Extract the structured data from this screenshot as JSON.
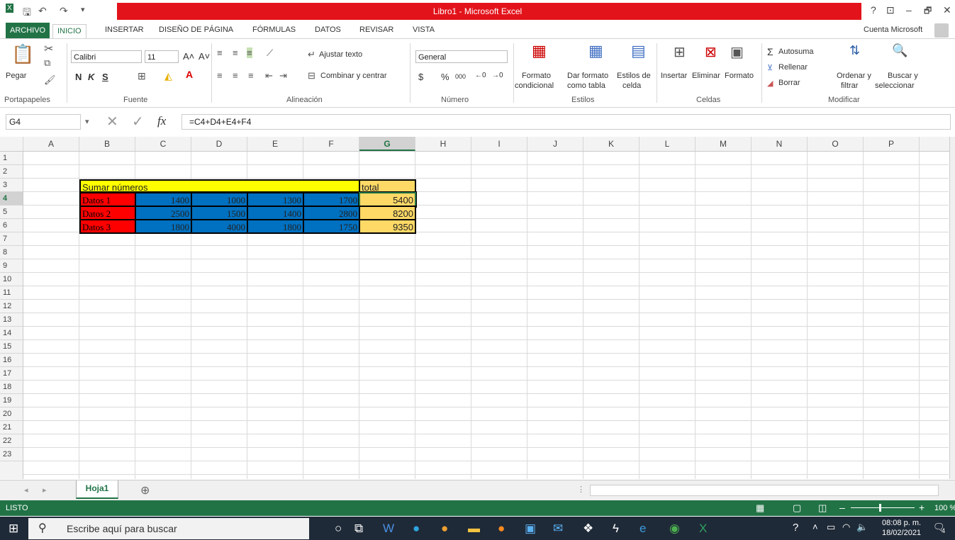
{
  "title": "Libro1 - Microsoft Excel",
  "window_buttons": [
    "?",
    "⊡",
    "–",
    "🗗",
    "✕"
  ],
  "tabs": {
    "file": "ARCHIVO",
    "items": [
      "INICIO",
      "INSERTAR",
      "DISEÑO DE PÁGINA",
      "FÓRMULAS",
      "DATOS",
      "REVISAR",
      "VISTA"
    ],
    "account": "Cuenta Microsoft"
  },
  "ribbon": {
    "clipboard": {
      "paste": "Pegar",
      "group": "Portapapeles"
    },
    "font": {
      "name": "Calibri",
      "size": "11",
      "bold": "N",
      "italic": "K",
      "underline": "S",
      "group": "Fuente"
    },
    "alignment": {
      "wrap": "Ajustar texto",
      "merge": "Combinar y centrar",
      "group": "Alineación"
    },
    "number": {
      "format": "General",
      "currency": "$",
      "percent": "%",
      "thousands": "000",
      "group": "Número"
    },
    "styles": {
      "conditional_1": "Formato",
      "conditional_2": "condicional",
      "table_1": "Dar formato",
      "table_2": "como tabla",
      "cell_1": "Estilos de",
      "cell_2": "celda",
      "group": "Estilos"
    },
    "cells": {
      "insert": "Insertar",
      "delete": "Eliminar",
      "format": "Formato",
      "group": "Celdas"
    },
    "editing": {
      "autosum": "Autosuma",
      "fill": "Rellenar",
      "clear": "Borrar",
      "sort_1": "Ordenar y",
      "sort_2": "filtrar",
      "find_1": "Buscar y",
      "find_2": "seleccionar",
      "group": "Modificar"
    }
  },
  "formula_bar": {
    "name_box": "G4",
    "fx": "fx",
    "formula": "=C4+D4+E4+F4"
  },
  "columns": [
    "A",
    "B",
    "C",
    "D",
    "E",
    "F",
    "G",
    "H",
    "I",
    "J",
    "K",
    "L",
    "M",
    "N",
    "O",
    "P"
  ],
  "selected_column": "G",
  "rows": [
    "1",
    "2",
    "3",
    "4",
    "5",
    "6",
    "7",
    "8",
    "9",
    "10",
    "11",
    "12",
    "13",
    "14",
    "15",
    "16",
    "17",
    "18",
    "19",
    "20",
    "21",
    "22",
    "23"
  ],
  "selected_row": "4",
  "cells": {
    "header_label": "Sumar números",
    "total_label": "total",
    "data_rows": [
      {
        "label": "Datos 1",
        "values": [
          "1400",
          "1000",
          "1300",
          "1700"
        ],
        "total": "5400"
      },
      {
        "label": "Datos 2",
        "values": [
          "2500",
          "1500",
          "1400",
          "2800"
        ],
        "total": "8200"
      },
      {
        "label": "Datos 3",
        "values": [
          "1800",
          "4000",
          "1800",
          "1750"
        ],
        "total": "9350"
      }
    ]
  },
  "sheet": {
    "tab": "Hoja1",
    "add": "⊕"
  },
  "status": {
    "ready": "LISTO",
    "zoom": "100 %"
  },
  "taskbar": {
    "search_placeholder": "Escribe aquí para buscar",
    "time": "08:08 p. m.",
    "date": "18/02/2021",
    "notifications": "4"
  },
  "colors": {
    "excel_green": "#217346",
    "title_red": "#e3131b",
    "yellow": "#ffff00",
    "red": "#ff0000",
    "blue": "#0070c0",
    "orange": "#ffd966"
  }
}
